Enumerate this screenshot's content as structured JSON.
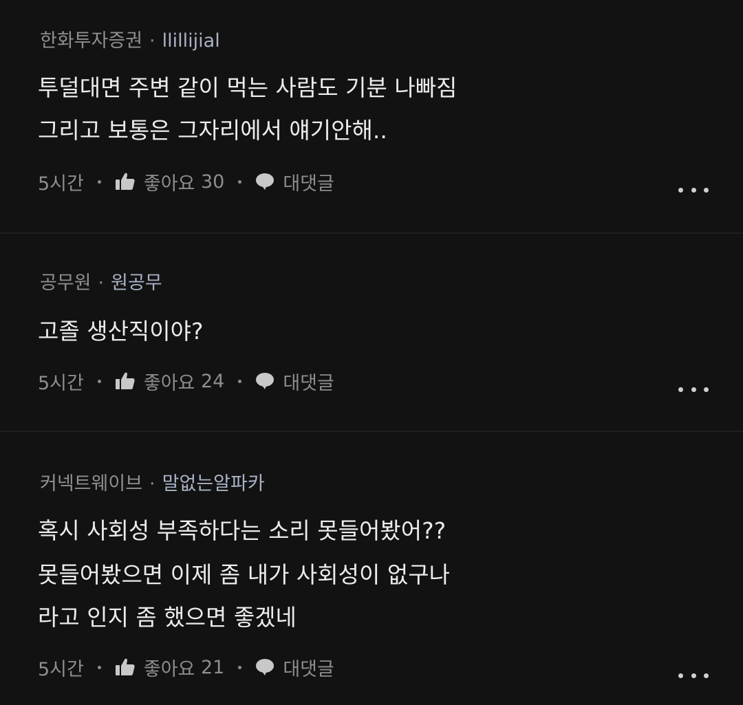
{
  "comments": [
    {
      "company": "한화투자증권",
      "nickname": "llillijial",
      "separator": "·",
      "lines": [
        "투덜대면 주변 같이 먹는 사람도 기분 나빠짐",
        "그리고 보통은 그자리에서 얘기안해.."
      ],
      "time": "5시간",
      "like_label": "좋아요",
      "like_count": "30",
      "reply_label": "대댓글"
    },
    {
      "company": "공무원",
      "nickname": "원공무",
      "separator": "·",
      "lines": [
        "고졸 생산직이야?"
      ],
      "time": "5시간",
      "like_label": "좋아요",
      "like_count": "24",
      "reply_label": "대댓글"
    },
    {
      "company": "커넥트웨이브",
      "nickname": "말없는알파카",
      "separator": "·",
      "lines": [
        "혹시 사회성 부족하다는 소리 못들어봤어??",
        "못들어봤으면 이제 좀 내가 사회성이 없구나",
        "라고 인지 좀 했으면 좋겠네"
      ],
      "time": "5시간",
      "like_label": "좋아요",
      "like_count": "21",
      "reply_label": "대댓글"
    }
  ],
  "icons": {
    "like": "thumbs-up-icon",
    "reply": "speech-bubble-icon",
    "more": "more-dots-icon"
  },
  "colors": {
    "background": "#121212",
    "body_text": "#ececec",
    "meta_text": "#8f8f93",
    "nickname": "#a9b3c7"
  }
}
